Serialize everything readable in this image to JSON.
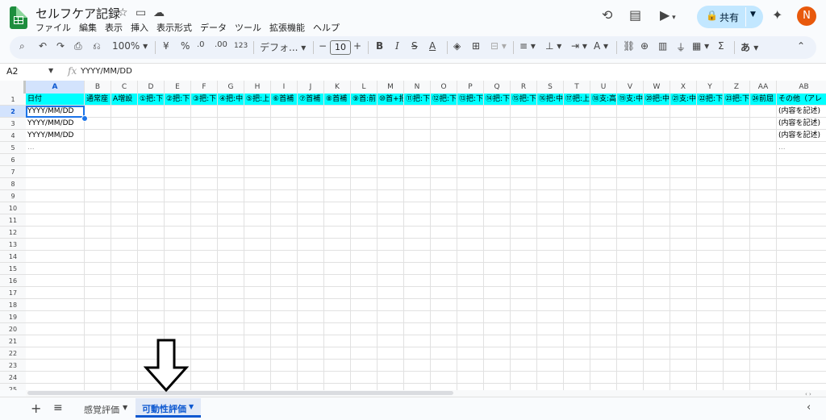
{
  "app": {
    "title": "セルフケア記録",
    "user_initial": "N"
  },
  "menu": [
    "ファイル",
    "編集",
    "表示",
    "挿入",
    "表示形式",
    "データ",
    "ツール",
    "拡張機能",
    "ヘルプ"
  ],
  "share": {
    "label": "共有"
  },
  "toolbar": {
    "zoom": "100%",
    "currency": "¥",
    "percent": "%",
    "dec_less": ".0",
    "dec_more": ".00",
    "number_format": "123",
    "font": "デフォ...",
    "font_size": "10",
    "bold": "B",
    "italic": "I",
    "input_tools": "あ"
  },
  "formula_bar": {
    "cell_ref": "A2",
    "fx": "fx",
    "value": "YYYY/MM/DD"
  },
  "columns": [
    "A",
    "B",
    "C",
    "D",
    "E",
    "F",
    "G",
    "H",
    "I",
    "J",
    "K",
    "L",
    "M",
    "N",
    "O",
    "P",
    "Q",
    "R",
    "S",
    "T",
    "U",
    "V",
    "W",
    "X",
    "Y",
    "Z",
    "AA",
    "AB"
  ],
  "header_row": [
    "日付",
    "通常座",
    "A増設",
    "①把:下",
    "②把:下",
    "③把:下",
    "④把:中",
    "⑤把:上",
    "⑥首補",
    "⑦首補",
    "⑧首補",
    "⑨首:前",
    "⑩首+把",
    "⑪把:下",
    "⑫把:下",
    "⑬把:下",
    "⑭把:下",
    "⑮把:下",
    "⑯把:中",
    "⑰把:上",
    "⑱支:高",
    "⑲支:中",
    "⑳把:中",
    "㉑支:中",
    "㉒把:下",
    "㉓把:下",
    "㉔前屈",
    "その他（アレ"
  ],
  "rows": [
    {
      "num": "2",
      "a": "YYYY/MM/DD",
      "ab": "(内容を記述)"
    },
    {
      "num": "3",
      "a": "YYYY/MM/DD",
      "ab": "(内容を記述)"
    },
    {
      "num": "4",
      "a": "YYYY/MM/DD",
      "ab": "(内容を記述)"
    },
    {
      "num": "5",
      "a": "...",
      "ab": "..."
    }
  ],
  "empty_rows": [
    "6",
    "7",
    "8",
    "9",
    "10",
    "11",
    "12",
    "13",
    "14",
    "15",
    "16",
    "17",
    "18",
    "19",
    "20",
    "21",
    "22",
    "23",
    "24",
    "25"
  ],
  "sheets": [
    {
      "label": "感覚評価"
    },
    {
      "label": "可動性評価"
    }
  ],
  "colors": {
    "header_fill": "#00ffff",
    "accent": "#0b57d0",
    "share_bg": "#c2e7ff",
    "avatar": "#e8590c"
  }
}
